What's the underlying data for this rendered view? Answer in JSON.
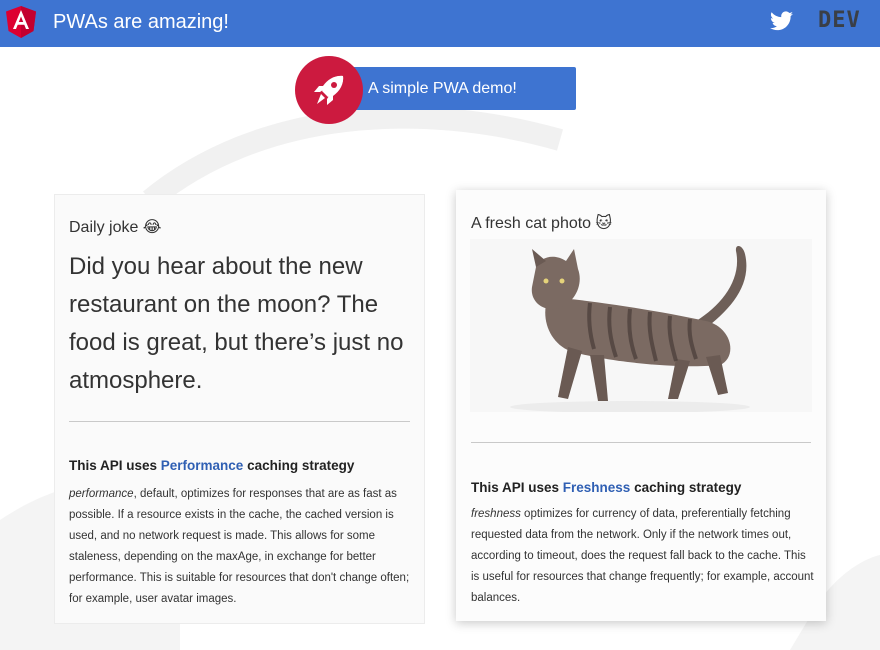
{
  "toolbar": {
    "title": "PWAs are amazing!",
    "angular_logo_icon": "angular-logo",
    "twitter_icon": "twitter-bird",
    "dev_logo_text": "DEV"
  },
  "hero": {
    "label": "A simple PWA demo!",
    "icon": "rocket-icon"
  },
  "cards": {
    "joke": {
      "title": "Daily joke 😂",
      "text": "Did you hear about the new restaurant on the moon? The food is great, but there’s just no atmosphere.",
      "strategy_prefix": "This API uses ",
      "strategy_name": "Performance",
      "strategy_suffix": " caching strategy",
      "desc_term": "performance",
      "desc_rest": ", default, optimizes for responses that are as fast as possible. If a resource exists in the cache, the cached version is used, and no network request is made. This allows for some staleness, depending on the maxAge, in exchange for better performance. This is suitable for resources that don't change often; for example, user avatar images."
    },
    "cat": {
      "title": "A fresh cat photo 🐱",
      "strategy_prefix": "This API uses ",
      "strategy_name": "Freshness",
      "strategy_suffix": " caching strategy",
      "desc_term": "freshness",
      "desc_rest": " optimizes for currency of data, preferentially fetching requested data from the network. Only if the network times out, according to timeout, does the request fall back to the cache. This is useful for resources that change frequently; for example, account balances."
    }
  },
  "colors": {
    "primary": "#3e74d1",
    "accent": "#cc1a3f",
    "link": "#2f5fb3"
  }
}
